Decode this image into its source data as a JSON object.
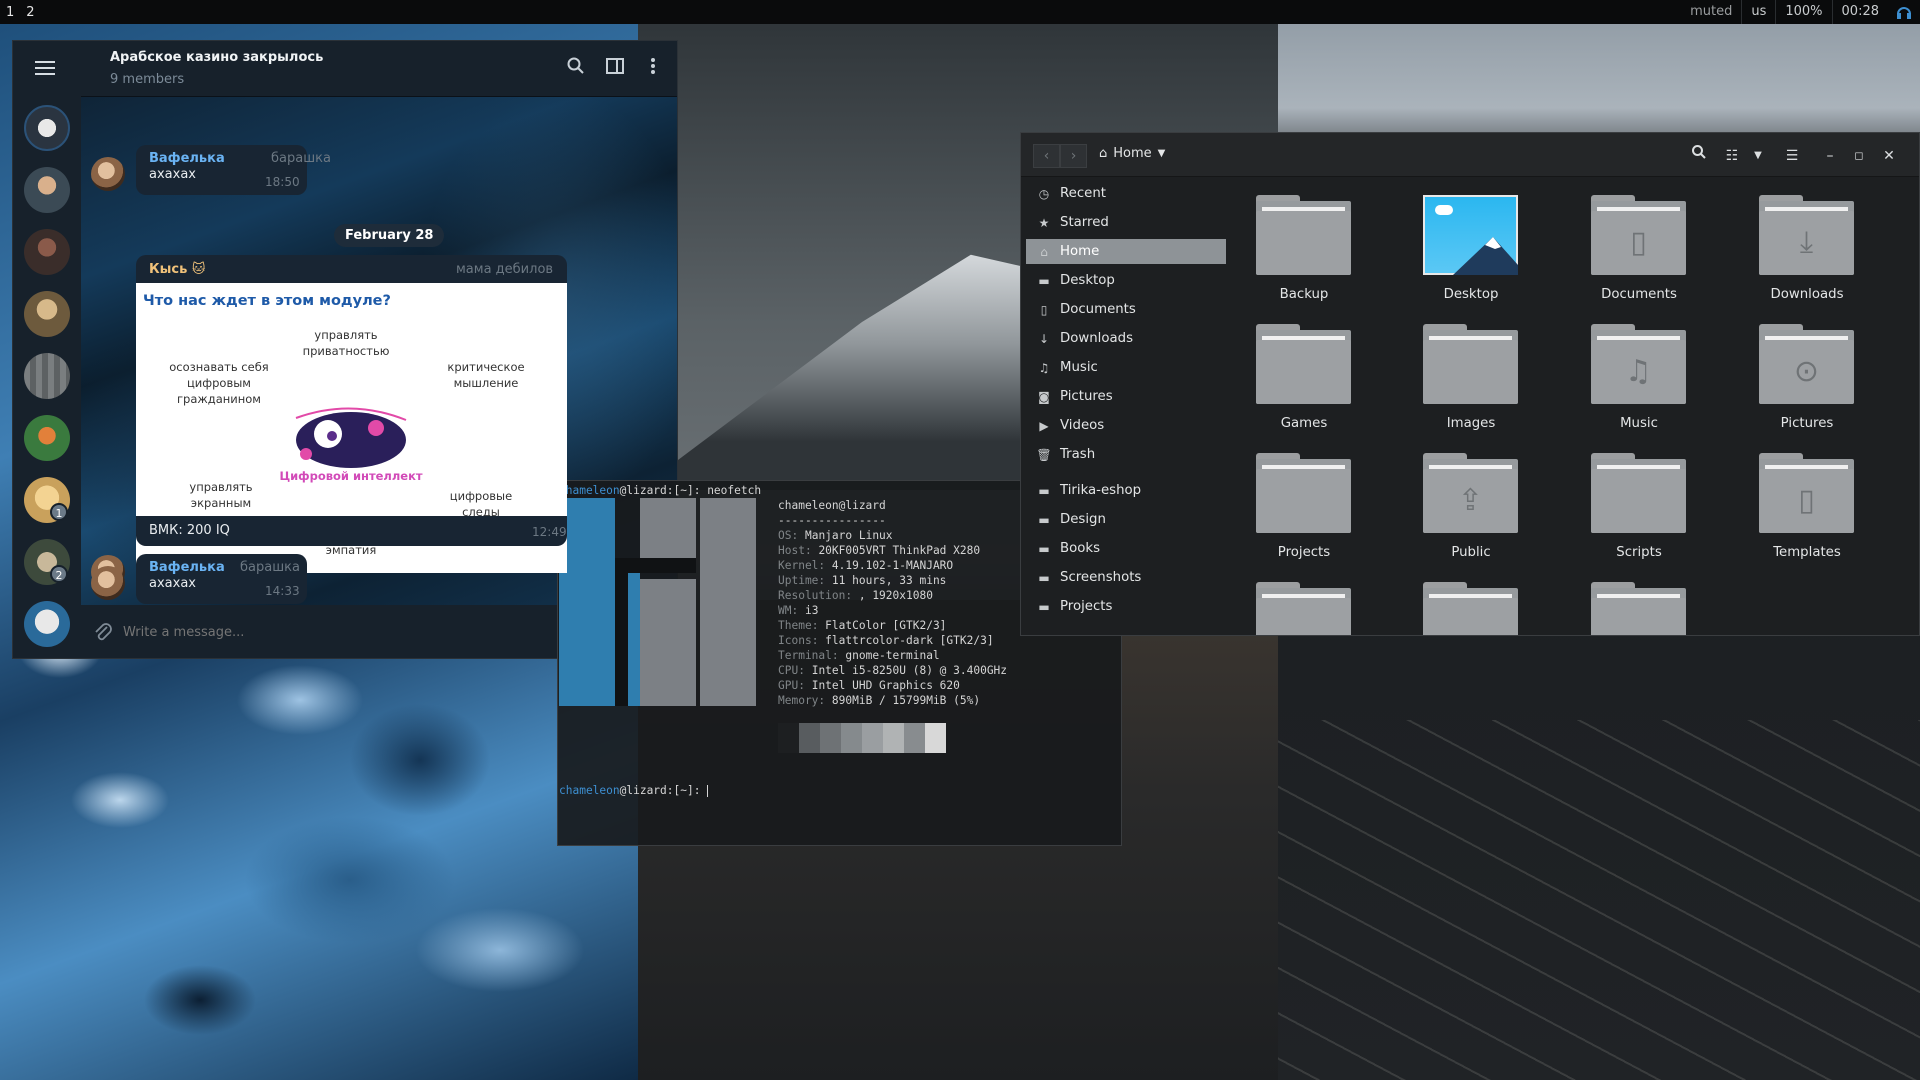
{
  "topbar": {
    "workspaces": [
      "1",
      "2"
    ],
    "status": {
      "muted": "muted",
      "layout": "us",
      "brightness": "100%",
      "clock": "00:28"
    }
  },
  "telegram": {
    "chat_title": "Арабское казино закрылось",
    "members": "9 members",
    "unread_badges": [
      "1",
      "2"
    ],
    "messages": [
      {
        "author": "Вафелька",
        "tag": "барашка",
        "text": "ахахах",
        "time": "18:50"
      },
      {
        "date": "February 28"
      },
      {
        "author": "Кысь 🐱",
        "tag": "мама дебилов",
        "image": {
          "heading": "Что нас ждет в этом модуле?",
          "center": "Цифровой интеллект",
          "labels": [
            "управлять приватностью",
            "критическое мышление",
            "осознавать себя цифровым гражданином",
            "управлять экранным временем",
            "цифровая эмпатия",
            "цифровые следы"
          ]
        },
        "text": "ВМК: 200 IQ",
        "time": "12:49"
      },
      {
        "author": "Вафелька",
        "tag": "барашка",
        "text": "ахахах",
        "time": "14:33"
      }
    ],
    "composer_placeholder": "Write a message..."
  },
  "terminal": {
    "prompt_user": "chameleon",
    "prompt_rest": "@lizard:[~]: ",
    "command": "neofetch",
    "header": "chameleon@lizard",
    "separator": "----------------",
    "info": [
      {
        "k": "OS",
        "v": "Manjaro Linux"
      },
      {
        "k": "Host",
        "v": "20KF005VRT ThinkPad X280"
      },
      {
        "k": "Kernel",
        "v": "4.19.102-1-MANJARO"
      },
      {
        "k": "Uptime",
        "v": "11 hours, 33 mins"
      },
      {
        "k": "Resolution",
        "v": ", 1920x1080"
      },
      {
        "k": "WM",
        "v": "i3"
      },
      {
        "k": "Theme",
        "v": "FlatColor [GTK2/3]"
      },
      {
        "k": "Icons",
        "v": "flattrcolor-dark [GTK2/3]"
      },
      {
        "k": "Terminal",
        "v": "gnome-terminal"
      },
      {
        "k": "CPU",
        "v": "Intel i5-8250U (8) @ 3.400GHz"
      },
      {
        "k": "GPU",
        "v": "Intel UHD Graphics 620"
      },
      {
        "k": "Memory",
        "v": "890MiB / 15799MiB (5%)"
      }
    ],
    "palette": [
      "#1d1f21",
      "#585c5f",
      "#6e7275",
      "#858a8d",
      "#9a9ea1",
      "#b0b3b4",
      "#888c8f",
      "#d8d8d8"
    ]
  },
  "files": {
    "location": "Home",
    "sidebar": [
      {
        "label": "Recent",
        "icon": "clock-icon"
      },
      {
        "label": "Starred",
        "icon": "star-icon"
      },
      {
        "label": "Home",
        "icon": "home-icon",
        "selected": true
      },
      {
        "label": "Desktop",
        "icon": "folder-icon"
      },
      {
        "label": "Documents",
        "icon": "document-icon"
      },
      {
        "label": "Downloads",
        "icon": "download-icon"
      },
      {
        "label": "Music",
        "icon": "music-icon"
      },
      {
        "label": "Pictures",
        "icon": "camera-icon"
      },
      {
        "label": "Videos",
        "icon": "video-icon"
      },
      {
        "label": "Trash",
        "icon": "trash-icon"
      },
      {
        "label": "Tirika-eshop",
        "icon": "folder-icon"
      },
      {
        "label": "Design",
        "icon": "folder-icon"
      },
      {
        "label": "Books",
        "icon": "folder-icon"
      },
      {
        "label": "Screenshots",
        "icon": "folder-icon"
      },
      {
        "label": "Projects",
        "icon": "folder-icon"
      }
    ],
    "folders": [
      {
        "name": "Backup",
        "emblem": ""
      },
      {
        "name": "Desktop",
        "emblem": "desktop"
      },
      {
        "name": "Documents",
        "emblem": "▯"
      },
      {
        "name": "Downloads",
        "emblem": "⤓"
      },
      {
        "name": "Games",
        "emblem": ""
      },
      {
        "name": "Images",
        "emblem": ""
      },
      {
        "name": "Music",
        "emblem": "♫"
      },
      {
        "name": "Pictures",
        "emblem": "⊙"
      },
      {
        "name": "Projects",
        "emblem": ""
      },
      {
        "name": "Public",
        "emblem": "⇪"
      },
      {
        "name": "Scripts",
        "emblem": ""
      },
      {
        "name": "Templates",
        "emblem": "▯"
      }
    ]
  }
}
